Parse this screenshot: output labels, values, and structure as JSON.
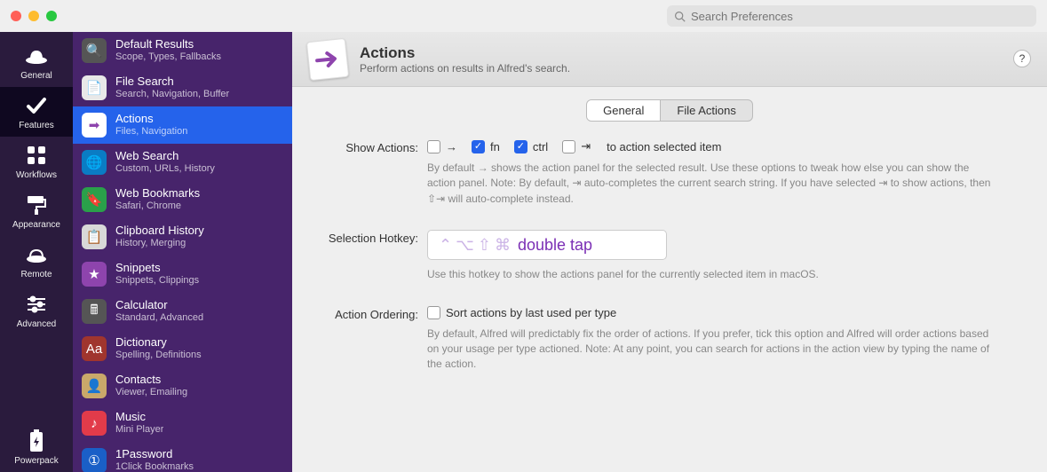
{
  "search_placeholder": "Search Preferences",
  "sidebar": {
    "items": [
      {
        "label": "General"
      },
      {
        "label": "Features"
      },
      {
        "label": "Workflows"
      },
      {
        "label": "Appearance"
      },
      {
        "label": "Remote"
      },
      {
        "label": "Advanced"
      }
    ],
    "bottom": {
      "label": "Powerpack"
    }
  },
  "features": [
    {
      "title": "Default Results",
      "subtitle": "Scope, Types, Fallbacks",
      "icon": "🔍",
      "bg": "#555"
    },
    {
      "title": "File Search",
      "subtitle": "Search, Navigation, Buffer",
      "icon": "📄",
      "bg": "#e8e8e8"
    },
    {
      "title": "Actions",
      "subtitle": "Files, Navigation",
      "icon": "➡",
      "bg": "#fff",
      "selected": true
    },
    {
      "title": "Web Search",
      "subtitle": "Custom, URLs, History",
      "icon": "🌐",
      "bg": "#0a7cc4"
    },
    {
      "title": "Web Bookmarks",
      "subtitle": "Safari, Chrome",
      "icon": "🔖",
      "bg": "#2aa04a"
    },
    {
      "title": "Clipboard History",
      "subtitle": "History, Merging",
      "icon": "📋",
      "bg": "#d8d8d8"
    },
    {
      "title": "Snippets",
      "subtitle": "Snippets, Clippings",
      "icon": "★",
      "bg": "#8e44ad"
    },
    {
      "title": "Calculator",
      "subtitle": "Standard, Advanced",
      "icon": "🖩",
      "bg": "#555"
    },
    {
      "title": "Dictionary",
      "subtitle": "Spelling, Definitions",
      "icon": "Aa",
      "bg": "#a0352e"
    },
    {
      "title": "Contacts",
      "subtitle": "Viewer, Emailing",
      "icon": "👤",
      "bg": "#c9a86a"
    },
    {
      "title": "Music",
      "subtitle": "Mini Player",
      "icon": "♪",
      "bg": "#e23b4a"
    },
    {
      "title": "1Password",
      "subtitle": "1Click Bookmarks",
      "icon": "①",
      "bg": "#1a5fc7"
    }
  ],
  "header": {
    "title": "Actions",
    "subtitle": "Perform actions on results in Alfred's search.",
    "help": "?"
  },
  "tabs": {
    "general": "General",
    "file_actions": "File Actions"
  },
  "show_actions": {
    "label": "Show Actions:",
    "arrow": "→",
    "fn": "fn",
    "ctrl": "ctrl",
    "tab": "⇥",
    "tail": "to action selected item",
    "desc": "By default → shows the action panel for the selected result. Use these options to tweak how else you can show the action panel. Note: By default, ⇥ auto-completes the current search string. If you have selected ⇥ to show actions, then ⇧⇥ will auto-complete instead."
  },
  "hotkey": {
    "label": "Selection Hotkey:",
    "display": "double tap",
    "desc": "Use this hotkey to show the actions panel for the currently selected item in macOS."
  },
  "ordering": {
    "label": "Action Ordering:",
    "checkbox": "Sort actions by last used per type",
    "desc": "By default, Alfred will predictably fix the order of actions. If you prefer, tick this option and Alfred will order actions based on your usage per type actioned. Note: At any point, you can search for actions in the action view by typing the name of the action."
  }
}
